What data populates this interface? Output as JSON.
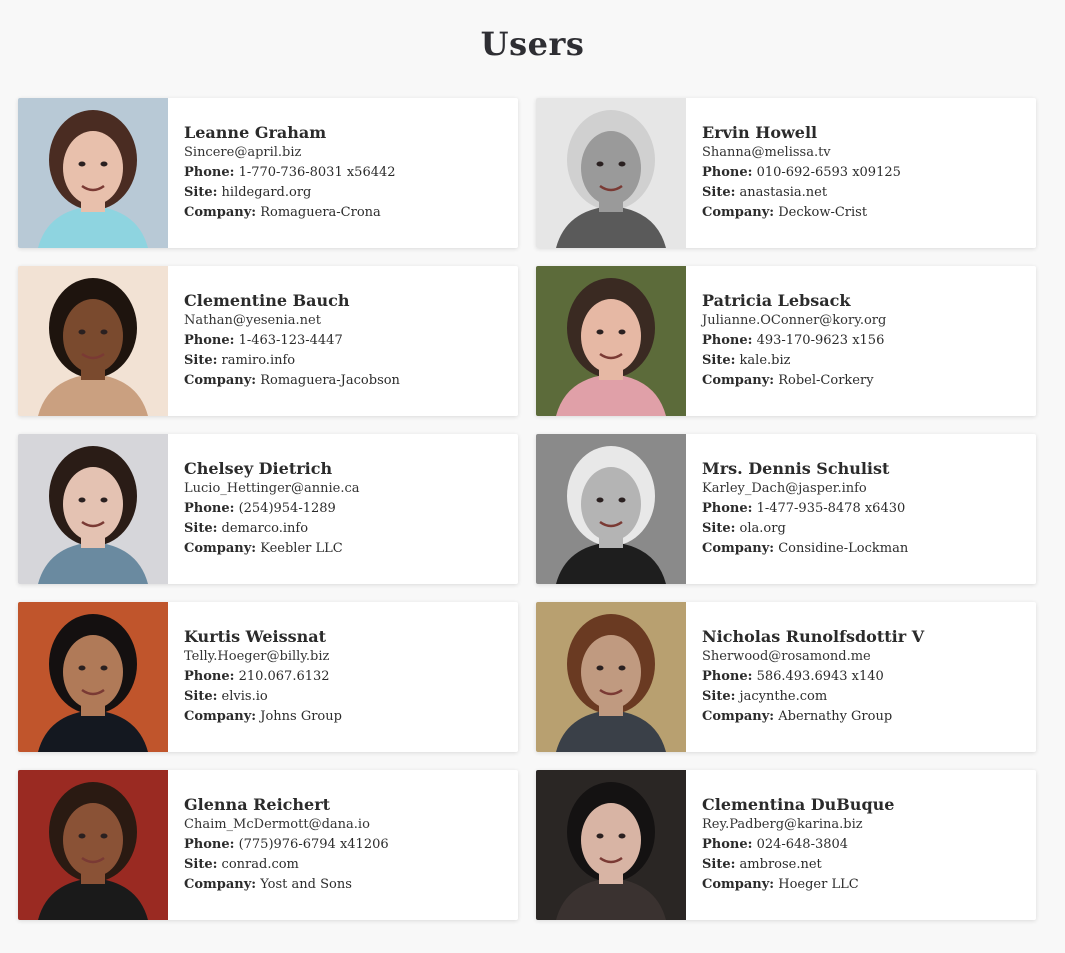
{
  "page": {
    "title": "Users"
  },
  "labels": {
    "phone": "Phone:",
    "site": "Site:",
    "company": "Company:"
  },
  "users": [
    {
      "name": "Leanne Graham",
      "email": "Sincere@april.biz",
      "phone": "1-770-736-8031 x56442",
      "site": "hildegard.org",
      "company": "Romaguera-Crona",
      "avatar": {
        "bg": "#b8c9d6",
        "skin": "#e8c0ac",
        "hair": "#4a2c22",
        "shirt": "#8ed4e0"
      }
    },
    {
      "name": "Ervin Howell",
      "email": "Shanna@melissa.tv",
      "phone": "010-692-6593 x09125",
      "site": "anastasia.net",
      "company": "Deckow-Crist",
      "avatar": {
        "bg": "#e6e6e6",
        "skin": "#9a9a9a",
        "hair": "#d0d0d0",
        "shirt": "#5a5a5a"
      }
    },
    {
      "name": "Clementine Bauch",
      "email": "Nathan@yesenia.net",
      "phone": "1-463-123-4447",
      "site": "ramiro.info",
      "company": "Romaguera-Jacobson",
      "avatar": {
        "bg": "#f2e2d4",
        "skin": "#7a4a2e",
        "hair": "#1e140e",
        "shirt": "#caa080"
      }
    },
    {
      "name": "Patricia Lebsack",
      "email": "Julianne.OConner@kory.org",
      "phone": "493-170-9623 x156",
      "site": "kale.biz",
      "company": "Robel-Corkery",
      "avatar": {
        "bg": "#5c6b3a",
        "skin": "#e6b8a4",
        "hair": "#3a2a22",
        "shirt": "#e0a0a8"
      }
    },
    {
      "name": "Chelsey Dietrich",
      "email": "Lucio_Hettinger@annie.ca",
      "phone": "(254)954-1289",
      "site": "demarco.info",
      "company": "Keebler LLC",
      "avatar": {
        "bg": "#d6d6da",
        "skin": "#e4c2b2",
        "hair": "#2a1c16",
        "shirt": "#6a8aa0"
      }
    },
    {
      "name": "Mrs. Dennis Schulist",
      "email": "Karley_Dach@jasper.info",
      "phone": "1-477-935-8478 x6430",
      "site": "ola.org",
      "company": "Considine-Lockman",
      "avatar": {
        "bg": "#8a8a8a",
        "skin": "#b4b4b4",
        "hair": "#e8e8e8",
        "shirt": "#1e1e1e"
      }
    },
    {
      "name": "Kurtis Weissnat",
      "email": "Telly.Hoeger@billy.biz",
      "phone": "210.067.6132",
      "site": "elvis.io",
      "company": "Johns Group",
      "avatar": {
        "bg": "#c0552c",
        "skin": "#b07a58",
        "hair": "#141010",
        "shirt": "#141820"
      }
    },
    {
      "name": "Nicholas Runolfsdottir V",
      "email": "Sherwood@rosamond.me",
      "phone": "586.493.6943 x140",
      "site": "jacynthe.com",
      "company": "Abernathy Group",
      "avatar": {
        "bg": "#b8a070",
        "skin": "#c09a80",
        "hair": "#6a3a22",
        "shirt": "#3a4048"
      }
    },
    {
      "name": "Glenna Reichert",
      "email": "Chaim_McDermott@dana.io",
      "phone": "(775)976-6794 x41206",
      "site": "conrad.com",
      "company": "Yost and Sons",
      "avatar": {
        "bg": "#9a2a22",
        "skin": "#8a5236",
        "hair": "#2a1a12",
        "shirt": "#1a1a1a"
      }
    },
    {
      "name": "Clementina DuBuque",
      "email": "Rey.Padberg@karina.biz",
      "phone": "024-648-3804",
      "site": "ambrose.net",
      "company": "Hoeger LLC",
      "avatar": {
        "bg": "#2a2624",
        "skin": "#d8b4a4",
        "hair": "#141212",
        "shirt": "#3a3230"
      }
    }
  ]
}
